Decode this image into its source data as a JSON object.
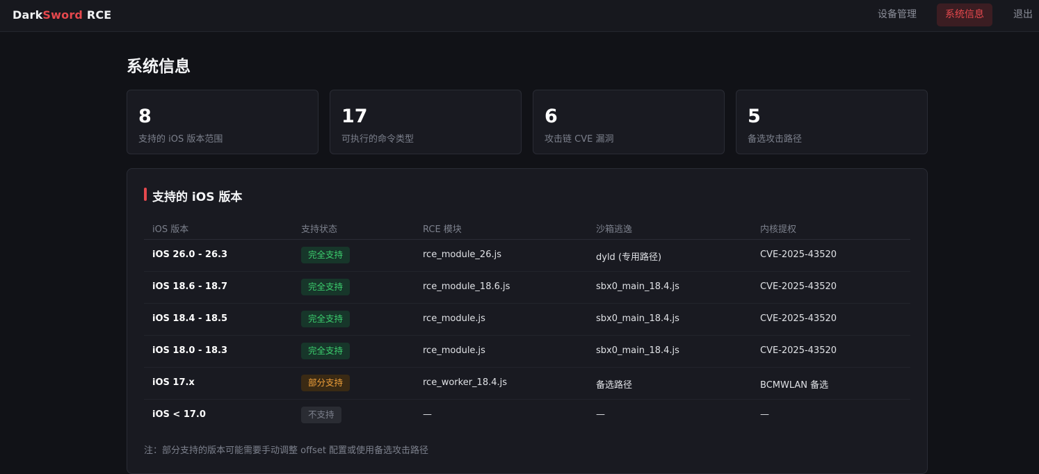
{
  "header": {
    "brand_part1": "Dark",
    "brand_part2": "Sword",
    "brand_part3": " RCE",
    "nav": {
      "devices": "设备管理",
      "sysinfo": "系统信息",
      "logout": "退出"
    }
  },
  "page": {
    "title": "系统信息"
  },
  "stats": [
    {
      "value": "8",
      "label": "支持的 iOS 版本范围"
    },
    {
      "value": "17",
      "label": "可执行的命令类型"
    },
    {
      "value": "6",
      "label": "攻击链 CVE 漏洞"
    },
    {
      "value": "5",
      "label": "备选攻击路径"
    }
  ],
  "panel": {
    "title": "支持的 iOS 版本",
    "columns": [
      "iOS 版本",
      "支持状态",
      "RCE 模块",
      "沙箱逃逸",
      "内核提权"
    ],
    "rows": [
      {
        "version": "iOS 26.0 - 26.3",
        "status": "完全支持",
        "rce": "rce_module_26.js",
        "sandbox": "dyld (专用路径)",
        "kernel": "CVE-2025-43520"
      },
      {
        "version": "iOS 18.6 - 18.7",
        "status": "完全支持",
        "rce": "rce_module_18.6.js",
        "sandbox": "sbx0_main_18.4.js",
        "kernel": "CVE-2025-43520"
      },
      {
        "version": "iOS 18.4 - 18.5",
        "status": "完全支持",
        "rce": "rce_module.js",
        "sandbox": "sbx0_main_18.4.js",
        "kernel": "CVE-2025-43520"
      },
      {
        "version": "iOS 18.0 - 18.3",
        "status": "完全支持",
        "rce": "rce_module.js",
        "sandbox": "sbx0_main_18.4.js",
        "kernel": "CVE-2025-43520"
      },
      {
        "version": "iOS 17.x",
        "status": "部分支持",
        "rce": "rce_worker_18.4.js",
        "sandbox": "备选路径",
        "kernel": "BCMWLAN 备选"
      },
      {
        "version": "iOS < 17.0",
        "status": "不支持",
        "rce": "—",
        "sandbox": "—",
        "kernel": "—"
      }
    ],
    "note": "注：部分支持的版本可能需要手动调整 offset 配置或使用备选攻击路径"
  },
  "colors": {
    "accent": "#e5484d",
    "full_support": "#3ccf6e",
    "partial_support": "#f0a03a",
    "unsupported": "#7c808c"
  }
}
